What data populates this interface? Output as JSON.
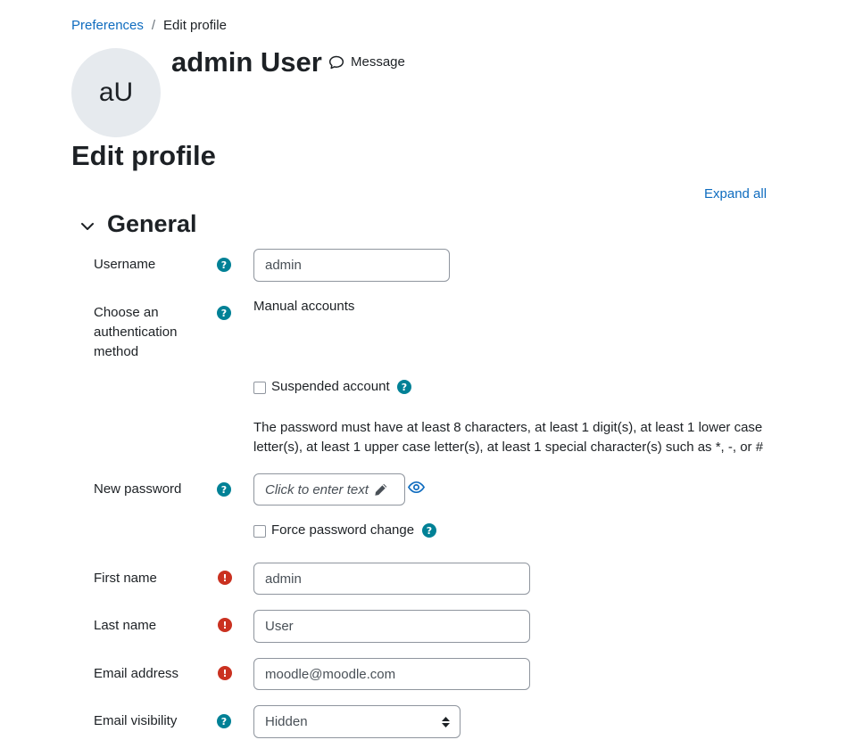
{
  "breadcrumb": {
    "items": [
      {
        "label": "Preferences"
      },
      {
        "label": "Edit profile"
      }
    ],
    "separator": "/"
  },
  "header": {
    "avatar_initials": "aU",
    "user_name": "admin User",
    "message_label": "Message",
    "page_title": "Edit profile"
  },
  "actions": {
    "expand_all": "Expand all"
  },
  "section": {
    "title": "General"
  },
  "form": {
    "username": {
      "label": "Username",
      "value": "admin"
    },
    "auth_method": {
      "label": "Choose an authentication method",
      "value": "Manual accounts"
    },
    "suspended": {
      "label": "Suspended account",
      "checked": false
    },
    "password_rules": "The password must have at least 8 characters, at least 1 digit(s), at least 1 lower case letter(s), at least 1 upper case letter(s), at least 1 special character(s) such as *, -, or #",
    "new_password": {
      "label": "New password",
      "placeholder": "Click to enter text"
    },
    "force_change": {
      "label": "Force password change",
      "checked": false
    },
    "first_name": {
      "label": "First name",
      "value": "admin"
    },
    "last_name": {
      "label": "Last name",
      "value": "User"
    },
    "email": {
      "label": "Email address",
      "value": "moodle@moodle.com"
    },
    "email_visibility": {
      "label": "Email visibility",
      "value": "Hidden"
    }
  },
  "icons": {
    "help": "?",
    "required": "!"
  },
  "colors": {
    "link": "#0f6cbf",
    "help": "#008196",
    "required": "#ca3120",
    "avatar_bg": "#e6eaee"
  }
}
